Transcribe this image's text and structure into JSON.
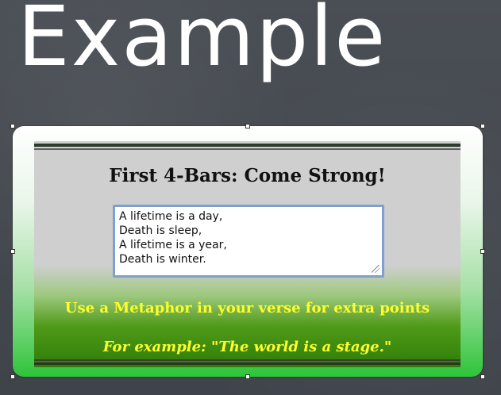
{
  "slide": {
    "title": "Example"
  },
  "panel": {
    "heading": "First 4-Bars: Come Strong!",
    "lyrics": [
      "A lifetime is a day,",
      "Death is sleep,",
      "A lifetime is a year,",
      "Death is winter."
    ],
    "tip": "Use a Metaphor in your verse for extra points",
    "example": "For example: \"The world is a stage.\""
  },
  "colors": {
    "background": "#44494f",
    "frame_green": "#2ec43a",
    "tip_text": "#ffff2a",
    "textarea_border": "#7f9fcf"
  }
}
